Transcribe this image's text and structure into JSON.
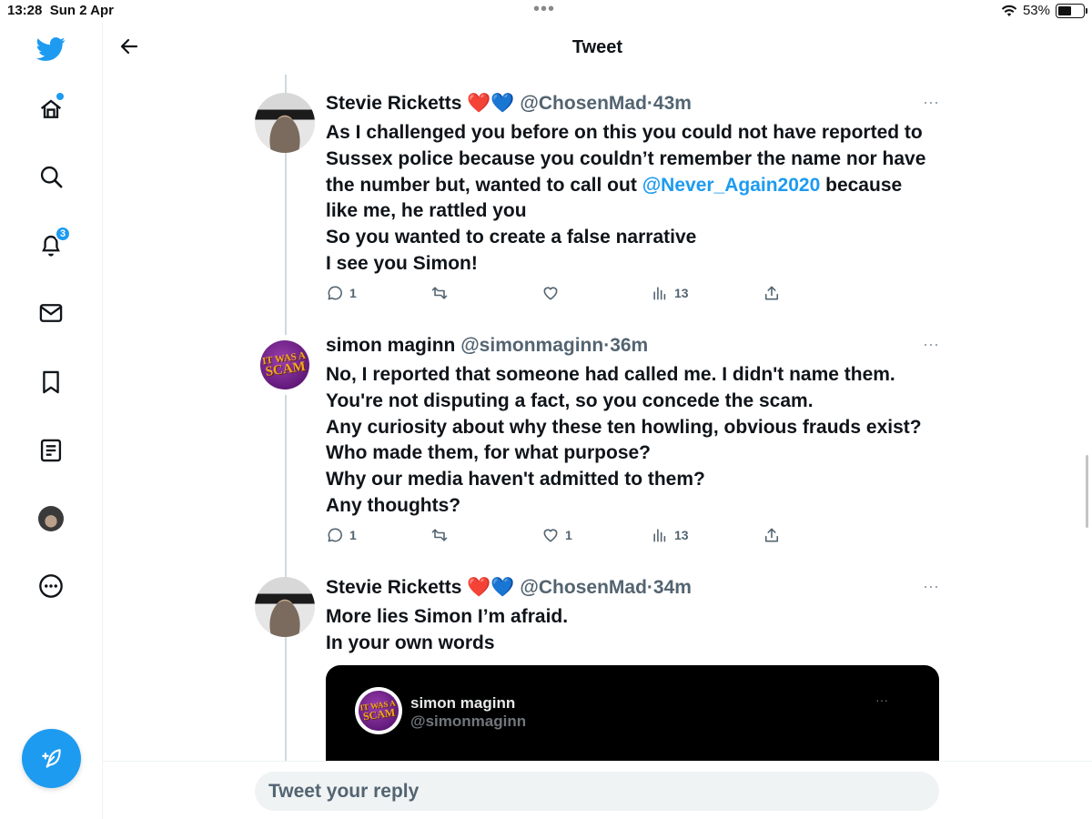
{
  "status_bar": {
    "time": "13:28",
    "date": "Sun 2 Apr",
    "battery": "53%",
    "battery_level": 0.53
  },
  "header": {
    "title": "Tweet"
  },
  "sidebar": {
    "items": [
      {
        "icon": "twitter-logo-icon"
      },
      {
        "icon": "home-icon"
      },
      {
        "icon": "search-icon"
      },
      {
        "icon": "bell-icon",
        "badge": "3"
      },
      {
        "icon": "mail-icon"
      },
      {
        "icon": "bookmark-icon"
      },
      {
        "icon": "list-icon"
      },
      {
        "icon": "profile-avatar"
      },
      {
        "icon": "more-circle-icon"
      },
      {
        "icon": "compose-icon"
      }
    ]
  },
  "tweets": [
    {
      "name": "Stevie Ricketts",
      "emoji": "❤️💙",
      "handle": "@ChosenMad",
      "sep": "·",
      "time": "43m",
      "lines": [
        "As I challenged you before on this you could not have reported to",
        "Sussex police because you couldn’t remember the name nor have",
        "the number but, wanted to call out",
        "@Never_Again2020",
        "because",
        "like me, he rattled you",
        "So you wanted to create a false narrative",
        "I see you Simon!"
      ],
      "replies": "1",
      "retweets": "",
      "likes": "",
      "views": "13"
    },
    {
      "name": "simon maginn",
      "handle": "@simonmaginn",
      "sep": "·",
      "time": "36m",
      "lines": [
        "No, I reported that someone had called me. I didn't name them.",
        "You're not disputing a fact, so you concede the scam.",
        "Any curiosity about why these ten howling, obvious frauds exist?",
        "Who made them, for what purpose?",
        "Why our media haven't admitted to them?",
        "Any thoughts?"
      ],
      "replies": "1",
      "retweets": "",
      "likes": "1",
      "views": "13"
    },
    {
      "name": "Stevie Ricketts",
      "emoji": "❤️💙",
      "handle": "@ChosenMad",
      "sep": "·",
      "time": "34m",
      "lines": [
        "More lies Simon I’m afraid.",
        "In your own words"
      ]
    }
  ],
  "avatar_logo": {
    "line1": "IT WAS A",
    "line2": "SCAM"
  },
  "quoted": {
    "name": "simon maginn",
    "handle": "@simonmaginn",
    "more": "···"
  },
  "more_glyph": "···",
  "reply": {
    "placeholder": "Tweet your reply"
  },
  "colors": {
    "accent": "#1d9bf0",
    "secondary_text": "#536471",
    "quote_bg": "#000000"
  }
}
